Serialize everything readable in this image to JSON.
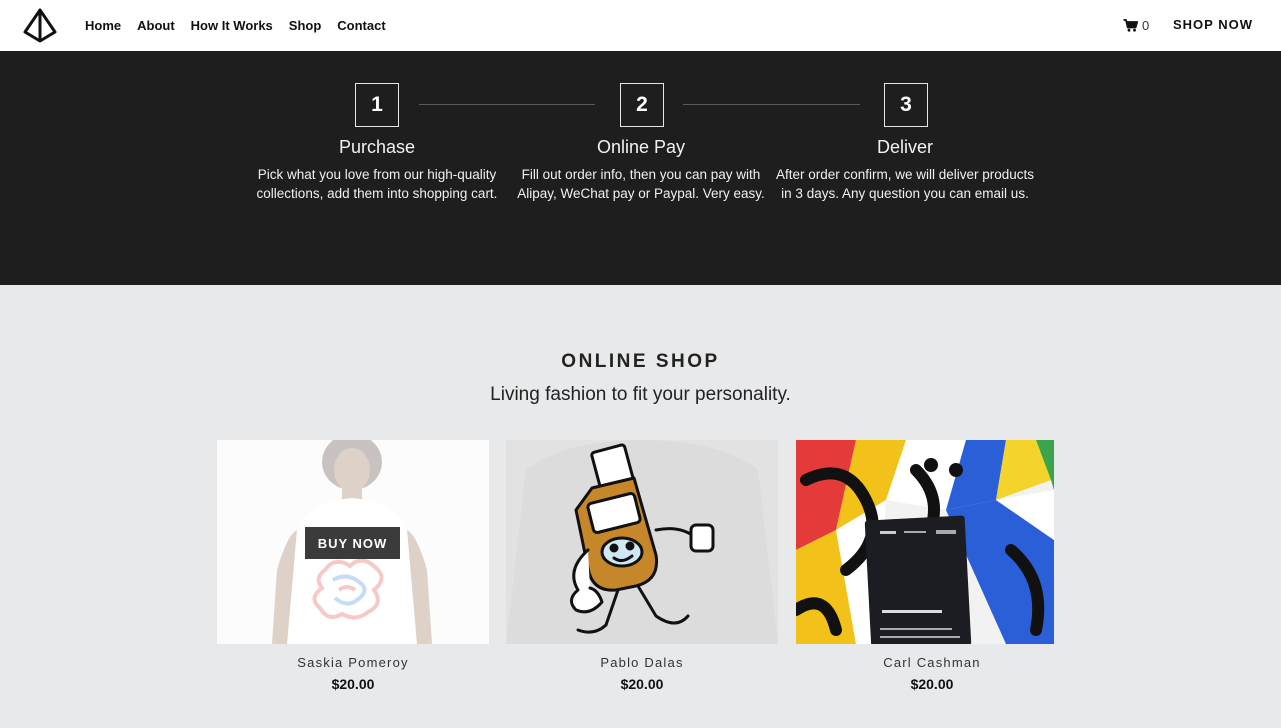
{
  "header": {
    "nav": [
      "Home",
      "About",
      "How It Works",
      "Shop",
      "Contact"
    ],
    "cart_count": "0",
    "cta": "SHOP NOW",
    "logo_icon": "pyramid-logo-icon",
    "cart_icon": "shopping-cart-icon"
  },
  "steps": [
    {
      "number": "1",
      "title": "Purchase",
      "desc": "Pick what you love from our high-quality collections, add them into shopping cart."
    },
    {
      "number": "2",
      "title": "Online Pay",
      "desc": "Fill out order info, then you can pay with Alipay, WeChat pay or Paypal. Very easy."
    },
    {
      "number": "3",
      "title": "Deliver",
      "desc": "After order confirm, we will deliver products in 3 days. Any question you can email us."
    }
  ],
  "shop": {
    "title": "ONLINE SHOP",
    "subtitle": "Living fashion to fit your personality.",
    "buy_now": "BUY NOW",
    "products": [
      {
        "name": "Saskia Pomeroy",
        "price": "$20.00"
      },
      {
        "name": "Pablo Dalas",
        "price": "$20.00"
      },
      {
        "name": "Carl Cashman",
        "price": "$20.00"
      }
    ]
  },
  "colors": {
    "dark_band": "#1e1e1f",
    "page_bg": "#e8e9eb",
    "buy_button": "#3b3b3b"
  }
}
